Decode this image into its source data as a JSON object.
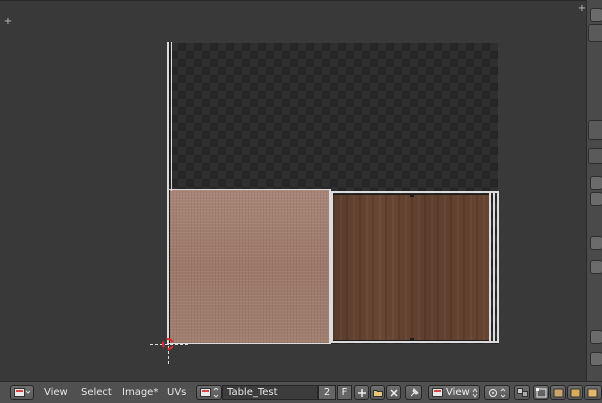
{
  "header": {
    "menus": [
      "View",
      "Select",
      "Image*",
      "UVs"
    ],
    "image_name": "Table_Test",
    "users_count": "2",
    "fake_user_label": "F",
    "view_mode": "View"
  },
  "colors": {
    "viewport_bg": "#393939",
    "header_bg": "#505050",
    "fabric": "#a58070",
    "wood": "#5f3f2e",
    "cursor_ring": "#e02b2b"
  }
}
